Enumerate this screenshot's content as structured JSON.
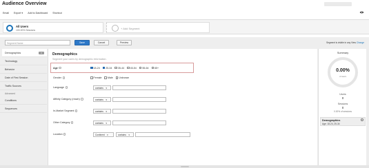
{
  "header": {
    "title": "Audience Overview",
    "toolbar": [
      "Email",
      "Export ▾",
      "Add to Dashboard",
      "Shortcut"
    ]
  },
  "segments": [
    {
      "name": "All Users",
      "sub": "100.00% Sessions"
    },
    {
      "name": "+ Add Segment"
    }
  ],
  "editor": {
    "segment_name_placeholder": "Segment Name",
    "save_label": "Save",
    "cancel_label": "Cancel",
    "preview_label": "Preview",
    "visibility_text": "Segment is visible in any View",
    "change_label": "Change"
  },
  "sidebar": {
    "items": [
      {
        "label": "Demographics",
        "count": "0"
      },
      {
        "label": "Technology"
      },
      {
        "label": "Behavior"
      },
      {
        "label": "Date of First Session"
      },
      {
        "label": "Traffic Sources"
      }
    ],
    "advanced_heading": "Advanced",
    "advanced_items": [
      {
        "label": "Conditions"
      },
      {
        "label": "Sequences"
      }
    ]
  },
  "demographics": {
    "title": "Demographics",
    "subtitle": "Segment your users by demographic information.",
    "age": {
      "label": "Age",
      "options": [
        {
          "label": "18-24",
          "checked": true
        },
        {
          "label": "25-34",
          "checked": true
        },
        {
          "label": "35-44",
          "checked": false
        },
        {
          "label": "45-54",
          "checked": false
        },
        {
          "label": "55-64",
          "checked": false
        },
        {
          "label": "65+",
          "checked": false
        }
      ]
    },
    "gender": {
      "label": "Gender",
      "options": [
        {
          "label": "Female",
          "checked": false
        },
        {
          "label": "Male",
          "checked": false
        },
        {
          "label": "Unknown",
          "checked": false
        }
      ]
    },
    "language": {
      "label": "Language",
      "operator": "contains"
    },
    "affinity": {
      "label": "Affinity Category (reach)",
      "operator": "contains"
    },
    "in_market": {
      "label": "In-Market Segment",
      "operator": "contains"
    },
    "other": {
      "label": "Other Category",
      "operator": "contains"
    },
    "location": {
      "label": "Location",
      "scope": "Continent",
      "operator": "contains"
    }
  },
  "summary": {
    "title": "Summary",
    "percent": "0.00%",
    "percent_sub": "of users",
    "users_label": "Users",
    "users_value": "0",
    "sessions_label": "Sessions",
    "sessions_value": "0",
    "sessions_sub": "0.00% of sessions",
    "card_title": "Demographics",
    "card_detail": "Age: 18-24, 25-34"
  },
  "colors": {
    "accent": "#2d78c8",
    "highlight_border": "#d89a9a",
    "panel_bg": "#eeeeee"
  }
}
